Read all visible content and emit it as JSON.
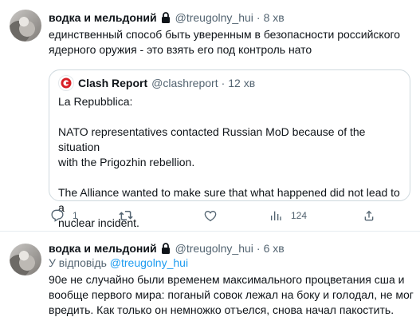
{
  "tweets": [
    {
      "author_name": "водка и мельдоний",
      "author_handle": "@treugolny_hui",
      "separator": "·",
      "time": "8 хв",
      "text_line1": "единственный способ быть уверенным в безопасности российского",
      "text_line2": "ядерного оружия - это взять его под контроль нато",
      "quote": {
        "author_name": "Clash Report",
        "author_handle": "@clashreport",
        "separator": "·",
        "time": "12 хв",
        "line1": "La Repubblica:",
        "line2": "NATO representatives contacted Russian MoD  because of the situation",
        "line3": "with the Prigozhin rebellion.",
        "line4": "The Alliance wanted to make sure that what happened did not lead to a",
        "line5": "nuclear incident."
      },
      "actions": {
        "reply_count": "1",
        "retweet_count": "",
        "like_count": "",
        "views_count": "124"
      }
    },
    {
      "author_name": "водка и мельдоний",
      "author_handle": "@treugolny_hui",
      "separator": "·",
      "time": "6 хв",
      "reply_prefix": "У відповідь ",
      "reply_handle": "@treugolny_hui",
      "text_line1": "90е не случайно были временем максимального процветания сша и",
      "text_line2": "вообще первого мира: поганый совок лежал на боку и голодал, не мог",
      "text_line3": "вредить. Как только он немножко отъелся, снова начал пакостить."
    }
  ],
  "colors": {
    "text": "#0f1419",
    "muted": "#536471",
    "link": "#1d9bf0",
    "border": "#cfd9de",
    "clash_brand": "#d81f26"
  },
  "icons": [
    "lock-icon",
    "clash-report-logo",
    "reply-icon",
    "retweet-icon",
    "like-icon",
    "views-icon",
    "share-icon"
  ]
}
